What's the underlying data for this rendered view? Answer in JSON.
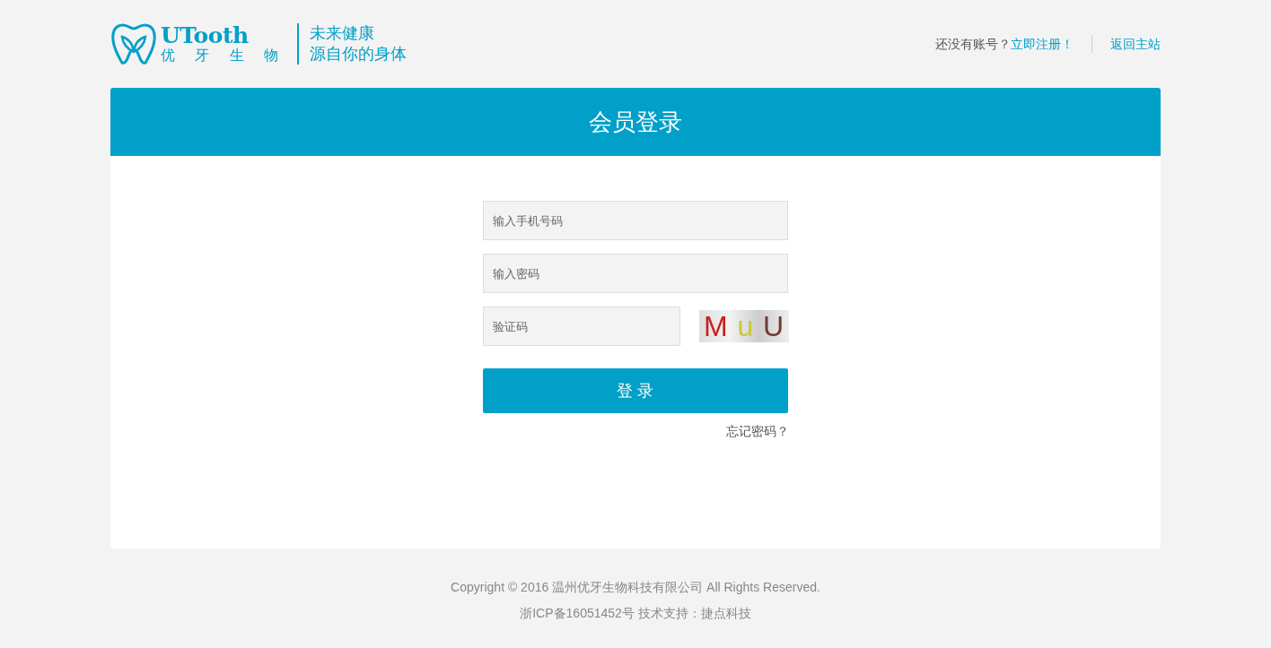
{
  "logo": {
    "brand": "UTooth",
    "brand_cn": "优 牙 生 物",
    "slogan": [
      "未来健康",
      "源自你的身体"
    ]
  },
  "header_links": {
    "prompt": "还没有账号？",
    "register": "立即注册！",
    "home": "返回主站"
  },
  "login": {
    "title": "会员登录",
    "fields": [
      {
        "kind": "text",
        "placeholder": "输入手机号码"
      },
      {
        "kind": "password",
        "placeholder": "输入密码"
      },
      {
        "kind": "captcha",
        "placeholder": "验证码"
      }
    ],
    "captcha_chars": [
      {
        "char": "M",
        "color": "#c8201c"
      },
      {
        "char": "u",
        "color": "#c8c83a"
      },
      {
        "char": "U",
        "color": "#6e3a2e"
      }
    ],
    "submit": "登 录",
    "forgot": "忘记密码？"
  },
  "footer": [
    "Copyright © 2016 温州优牙生物科技有限公司 All Rights Reserved.",
    "浙ICP备16051452号 技术支持：捷点科技"
  ]
}
